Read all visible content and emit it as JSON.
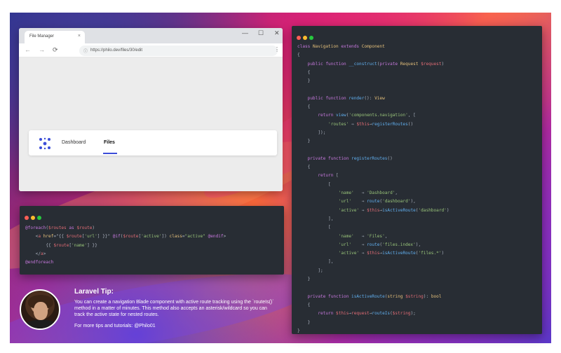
{
  "browser": {
    "tab_title": "File Manager",
    "tab_close": "×",
    "minimize": "—",
    "maximize": "☐",
    "close": "✕",
    "url": "https://philo.dev/files/30/edit",
    "nav_items": [
      {
        "label": "Dashboard",
        "active": false
      },
      {
        "label": "Files",
        "active": true
      }
    ]
  },
  "blade_code": {
    "lines": [
      [
        [
          "kw",
          "@foreach"
        ],
        [
          "pl",
          "("
        ],
        [
          "vr",
          "$routes"
        ],
        [
          "kw",
          " as "
        ],
        [
          "vr",
          "$route"
        ],
        [
          "pl",
          ")"
        ]
      ],
      [
        [
          "pl",
          "    <"
        ],
        [
          "vr",
          "a"
        ],
        [
          "ty",
          " href"
        ],
        [
          "pl",
          "=\""
        ],
        [
          "pl",
          "{{ "
        ],
        [
          "vr",
          "$route"
        ],
        [
          "pl",
          "["
        ],
        [
          "str",
          "'url'"
        ],
        [
          "pl",
          "] }}"
        ],
        [
          "pl",
          "\" "
        ],
        [
          "kw",
          "@if"
        ],
        [
          "pl",
          "("
        ],
        [
          "vr",
          "$route"
        ],
        [
          "pl",
          "["
        ],
        [
          "str",
          "'active'"
        ],
        [
          "pl",
          "]) "
        ],
        [
          "ty",
          "class"
        ],
        [
          "pl",
          "="
        ],
        [
          "str",
          "\"active\""
        ],
        [
          "kw",
          " @endif"
        ],
        [
          "pl",
          ">"
        ]
      ],
      [
        [
          "pl",
          "        {{ "
        ],
        [
          "vr",
          "$route"
        ],
        [
          "pl",
          "["
        ],
        [
          "str",
          "'name'"
        ],
        [
          "pl",
          "] }}"
        ]
      ],
      [
        [
          "pl",
          "    </"
        ],
        [
          "vr",
          "a"
        ],
        [
          "pl",
          ">"
        ]
      ],
      [
        [
          "kw",
          "@endforeach"
        ]
      ]
    ]
  },
  "php_code": {
    "lines": [
      [
        [
          "kw",
          "class "
        ],
        [
          "ty",
          "Navigation"
        ],
        [
          "kw",
          " extends "
        ],
        [
          "ty",
          "Component"
        ]
      ],
      [
        [
          "pl",
          "{"
        ]
      ],
      [
        [
          "kw",
          "    public function "
        ],
        [
          "fn",
          "__construct"
        ],
        [
          "pl",
          "("
        ],
        [
          "kw",
          "private "
        ],
        [
          "ty",
          "Request "
        ],
        [
          "vr",
          "$request"
        ],
        [
          "pl",
          ")"
        ]
      ],
      [
        [
          "pl",
          "    {"
        ]
      ],
      [
        [
          "pl",
          "    }"
        ]
      ],
      [
        [
          "pl",
          ""
        ]
      ],
      [
        [
          "kw",
          "    public function "
        ],
        [
          "fn",
          "render"
        ],
        [
          "pl",
          "(): "
        ],
        [
          "ty",
          "View"
        ]
      ],
      [
        [
          "pl",
          "    {"
        ]
      ],
      [
        [
          "kw",
          "        return "
        ],
        [
          "fn",
          "view"
        ],
        [
          "pl",
          "("
        ],
        [
          "str",
          "'components.navigation'"
        ],
        [
          "pl",
          ", ["
        ]
      ],
      [
        [
          "str",
          "            'routes'"
        ],
        [
          "pl",
          " ⇒ "
        ],
        [
          "vr",
          "$this"
        ],
        [
          "pl",
          "→"
        ],
        [
          "fn",
          "registerRoutes"
        ],
        [
          "pl",
          "()"
        ]
      ],
      [
        [
          "pl",
          "        ]);"
        ]
      ],
      [
        [
          "pl",
          "    }"
        ]
      ],
      [
        [
          "pl",
          ""
        ]
      ],
      [
        [
          "kw",
          "    private function "
        ],
        [
          "fn",
          "registerRoutes"
        ],
        [
          "pl",
          "()"
        ]
      ],
      [
        [
          "pl",
          "    {"
        ]
      ],
      [
        [
          "kw",
          "        return "
        ],
        [
          "pl",
          "["
        ]
      ],
      [
        [
          "pl",
          "            ["
        ]
      ],
      [
        [
          "str",
          "                'name'"
        ],
        [
          "pl",
          "   ⇒ "
        ],
        [
          "str",
          "'Dashboard'"
        ],
        [
          "pl",
          ","
        ]
      ],
      [
        [
          "str",
          "                'url'"
        ],
        [
          "pl",
          "    ⇒ "
        ],
        [
          "fn",
          "route"
        ],
        [
          "pl",
          "("
        ],
        [
          "str",
          "'dashboard'"
        ],
        [
          "pl",
          "),"
        ]
      ],
      [
        [
          "str",
          "                'active'"
        ],
        [
          "pl",
          " ⇒ "
        ],
        [
          "vr",
          "$this"
        ],
        [
          "pl",
          "→"
        ],
        [
          "fn",
          "isActiveRoute"
        ],
        [
          "pl",
          "("
        ],
        [
          "str",
          "'dashboard'"
        ],
        [
          "pl",
          ")"
        ]
      ],
      [
        [
          "pl",
          "            ],"
        ]
      ],
      [
        [
          "pl",
          "            ["
        ]
      ],
      [
        [
          "str",
          "                'name'"
        ],
        [
          "pl",
          "   ⇒ "
        ],
        [
          "str",
          "'Files'"
        ],
        [
          "pl",
          ","
        ]
      ],
      [
        [
          "str",
          "                'url'"
        ],
        [
          "pl",
          "    ⇒ "
        ],
        [
          "fn",
          "route"
        ],
        [
          "pl",
          "("
        ],
        [
          "str",
          "'files.index'"
        ],
        [
          "pl",
          "),"
        ]
      ],
      [
        [
          "str",
          "                'active'"
        ],
        [
          "pl",
          " ⇒ "
        ],
        [
          "vr",
          "$this"
        ],
        [
          "pl",
          "→"
        ],
        [
          "fn",
          "isActiveRoute"
        ],
        [
          "pl",
          "("
        ],
        [
          "str",
          "'files.*'"
        ],
        [
          "pl",
          ")"
        ]
      ],
      [
        [
          "pl",
          "            ],"
        ]
      ],
      [
        [
          "pl",
          "        ];"
        ]
      ],
      [
        [
          "pl",
          "    }"
        ]
      ],
      [
        [
          "pl",
          ""
        ]
      ],
      [
        [
          "kw",
          "    private function "
        ],
        [
          "fn",
          "isActiveRoute"
        ],
        [
          "pl",
          "("
        ],
        [
          "ty",
          "string "
        ],
        [
          "vr",
          "$string"
        ],
        [
          "pl",
          "): "
        ],
        [
          "ty",
          "bool"
        ]
      ],
      [
        [
          "pl",
          "    {"
        ]
      ],
      [
        [
          "kw",
          "        return "
        ],
        [
          "vr",
          "$this"
        ],
        [
          "pl",
          "→"
        ],
        [
          "vr",
          "request"
        ],
        [
          "pl",
          "→"
        ],
        [
          "fn",
          "routeIs"
        ],
        [
          "pl",
          "("
        ],
        [
          "vr",
          "$string"
        ],
        [
          "pl",
          ");"
        ]
      ],
      [
        [
          "pl",
          "    }"
        ]
      ],
      [
        [
          "pl",
          "}"
        ]
      ]
    ]
  },
  "tip": {
    "title": "Laravel Tip:",
    "body": "You can create a navigation Blade component with active route tracking using the `routeIs()` method in a matter of minutes. This method also accepts an asterisk/wildcard so you can track the active state for nested routes.",
    "footer": "For more tips and tutorials: @Philo01"
  },
  "colors": {
    "traffic_red": "#ff5f56",
    "traffic_yellow": "#ffbd2e",
    "traffic_green": "#27c93f",
    "accent": "#3b4dd8"
  }
}
